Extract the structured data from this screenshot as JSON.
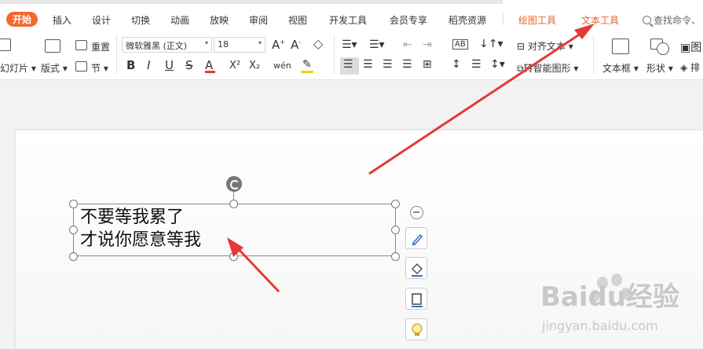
{
  "tabs": {
    "start": "开始",
    "items": [
      "插入",
      "设计",
      "切换",
      "动画",
      "放映",
      "审阅",
      "视图",
      "开发工具",
      "会员专享",
      "稻壳资源"
    ],
    "drawing_tools": "绘图工具",
    "text_tools": "文本工具",
    "search": "查找命令、"
  },
  "ribbon": {
    "new_slide": "幻灯片",
    "layout": "版式",
    "reset": "重置",
    "section": "节",
    "font_name": "微软雅黑 (正文)",
    "font_size": "18",
    "grow_font": "A",
    "shrink_font": "A",
    "bold": "B",
    "italic": "I",
    "underline": "U",
    "strike": "S",
    "font_color": "A",
    "superscript": "X²",
    "subscript": "X₂",
    "phonetic": "wén",
    "align_text": "对齐文本",
    "smart_art": "转智能图形",
    "textbox": "文本框",
    "shape": "形状",
    "arrange": "排"
  },
  "slide": {
    "text_line1": "不要等我累了",
    "text_line2": "才说你愿意等我"
  },
  "watermark": {
    "brand": "Baidu经验",
    "url": "jingyan.baidu.com"
  },
  "colors": {
    "accent": "#f26a2e",
    "arrow": "#e53935"
  }
}
